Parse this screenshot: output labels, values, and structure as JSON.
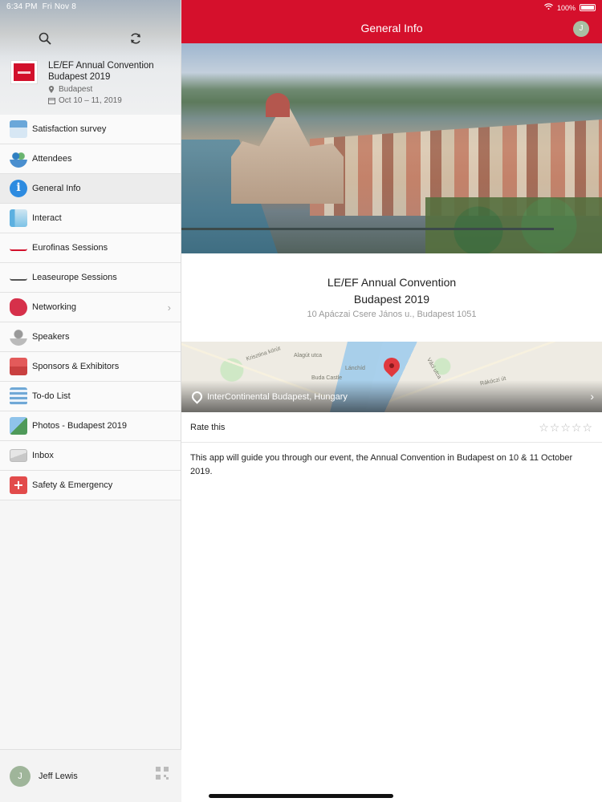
{
  "status_bar": {
    "time": "6:34 PM",
    "date": "Fri Nov 8",
    "battery": "100%"
  },
  "sidebar": {
    "event": {
      "title": "LE/EF Annual Convention Budapest 2019",
      "location": "Budapest",
      "dates": "Oct 10 – 11, 2019"
    },
    "items": [
      {
        "label": "Satisfaction survey",
        "icon": "survey-icon"
      },
      {
        "label": "Attendees",
        "icon": "attendees-icon"
      },
      {
        "label": "General Info",
        "icon": "info-icon",
        "active": true
      },
      {
        "label": "Interact",
        "icon": "interact-icon"
      },
      {
        "label": "Eurofinas Sessions",
        "icon": "eurofinas-icon"
      },
      {
        "label": "Leaseurope Sessions",
        "icon": "leaseurope-icon"
      },
      {
        "label": "Networking",
        "icon": "networking-icon",
        "has_chevron": true
      },
      {
        "label": "Speakers",
        "icon": "speakers-icon"
      },
      {
        "label": "Sponsors & Exhibitors",
        "icon": "sponsors-icon"
      },
      {
        "label": "To-do List",
        "icon": "todo-icon"
      },
      {
        "label": "Photos - Budapest 2019",
        "icon": "photos-icon"
      },
      {
        "label": "Inbox",
        "icon": "inbox-icon"
      },
      {
        "label": "Safety & Emergency",
        "icon": "safety-icon"
      }
    ],
    "footer": {
      "user_name": "Jeff Lewis",
      "avatar_initial": "J"
    }
  },
  "main": {
    "title": "General Info",
    "avatar_initial": "J",
    "event_title_line1": "LE/EF Annual Convention",
    "event_title_line2": "Budapest 2019",
    "address": "10 Apáczai Csere János u., Budapest 1051",
    "map": {
      "location": "InterContinental Budapest, Hungary",
      "labels": [
        "Krisztina körút",
        "Alagút utca",
        "Lánchíd",
        "Buda Castle",
        "Váci utca",
        "Rákóczi út"
      ]
    },
    "rate_label": "Rate this",
    "rating": 0,
    "rating_max": 5,
    "description": "This app will guide you through our event, the Annual Convention in Budapest on 10 & 11 October 2019."
  },
  "colors": {
    "brand_red": "#d5102c",
    "info_blue": "#2d8be0"
  }
}
